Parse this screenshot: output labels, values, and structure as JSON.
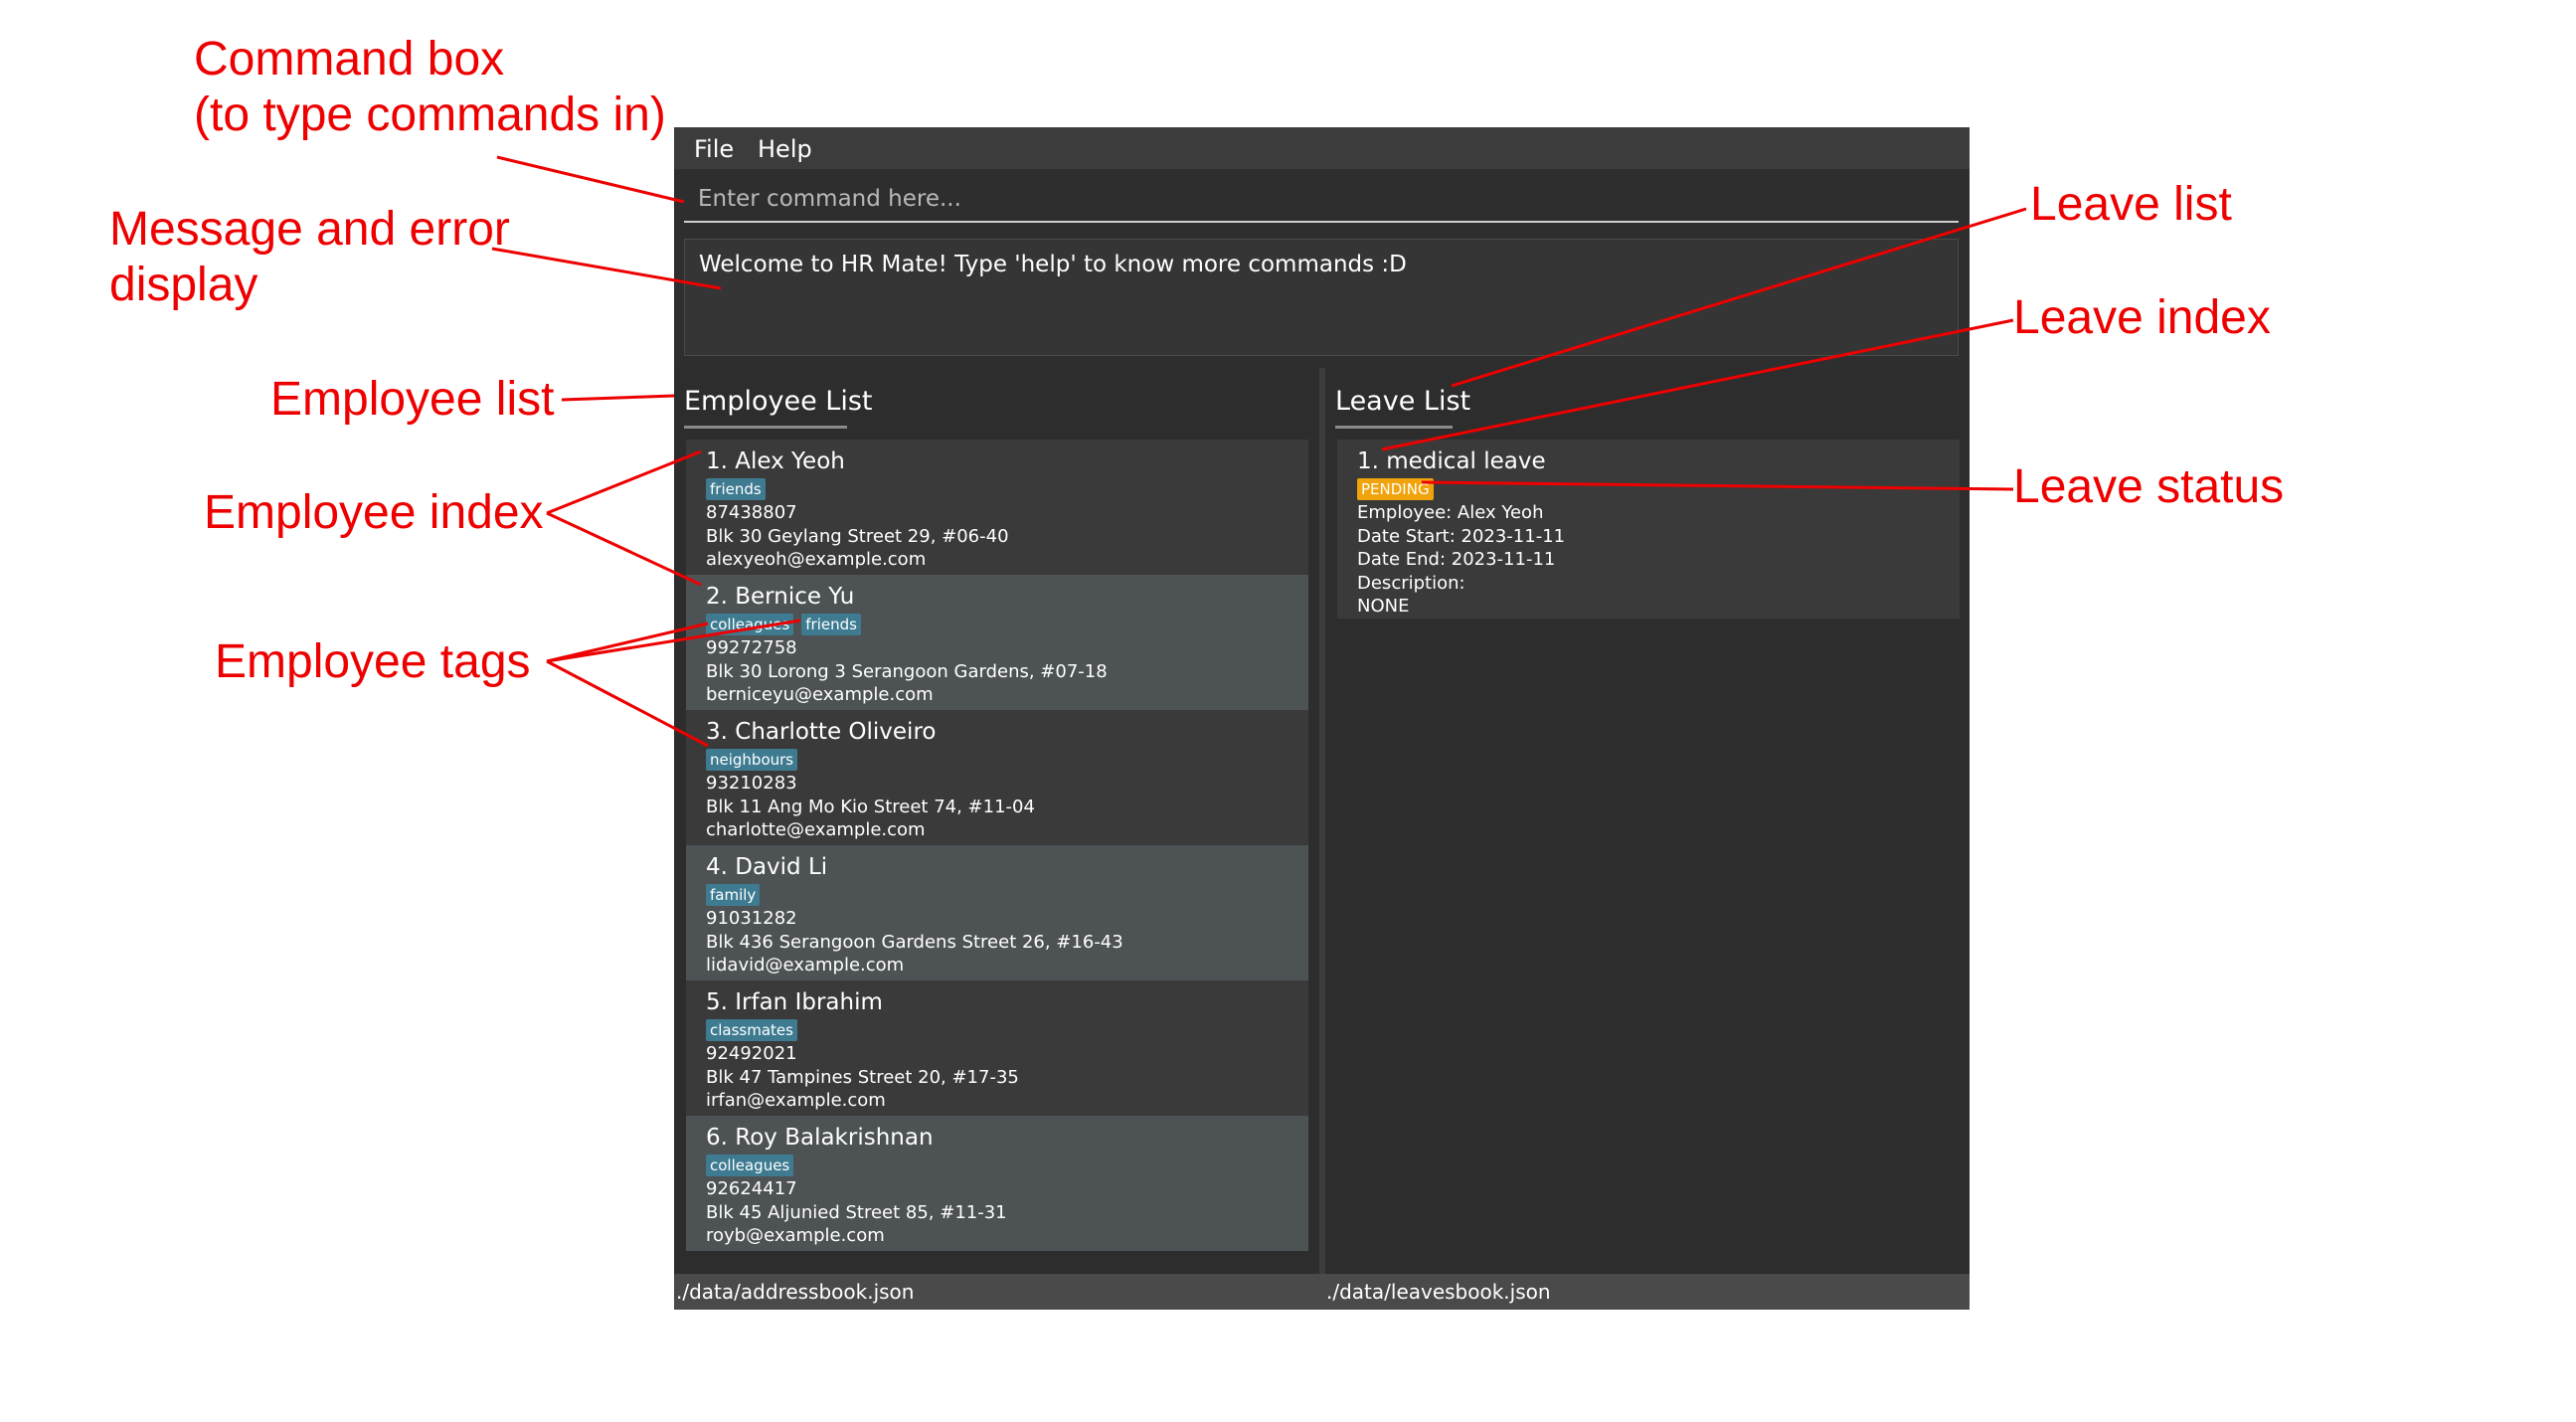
{
  "annotations": {
    "command_box_line1": "Command box",
    "command_box_line2": "(to type commands in)",
    "message_line1": "Message and error",
    "message_line2": "display",
    "employee_list": "Employee list",
    "employee_index": "Employee index",
    "employee_tags": "Employee tags",
    "leave_list": "Leave list",
    "leave_index": "Leave index",
    "leave_status": "Leave status"
  },
  "menu": {
    "file": "File",
    "help": "Help"
  },
  "command": {
    "placeholder": "Enter command here..."
  },
  "result": {
    "text": "Welcome to HR Mate! Type 'help' to know more commands :D"
  },
  "employee_panel": {
    "title": "Employee List",
    "employees": [
      {
        "title": "1.  Alex Yeoh",
        "tags": [
          "friends"
        ],
        "phone": "87438807",
        "address": "Blk 30 Geylang Street 29, #06-40",
        "email": "alexyeoh@example.com"
      },
      {
        "title": "2.  Bernice Yu",
        "tags": [
          "colleagues",
          "friends"
        ],
        "phone": "99272758",
        "address": "Blk 30 Lorong 3 Serangoon Gardens, #07-18",
        "email": "berniceyu@example.com"
      },
      {
        "title": "3.  Charlotte Oliveiro",
        "tags": [
          "neighbours"
        ],
        "phone": "93210283",
        "address": "Blk 11 Ang Mo Kio Street 74, #11-04",
        "email": "charlotte@example.com"
      },
      {
        "title": "4.  David Li",
        "tags": [
          "family"
        ],
        "phone": "91031282",
        "address": "Blk 436 Serangoon Gardens Street 26, #16-43",
        "email": "lidavid@example.com"
      },
      {
        "title": "5.  Irfan Ibrahim",
        "tags": [
          "classmates"
        ],
        "phone": "92492021",
        "address": "Blk 47 Tampines Street 20, #17-35",
        "email": "irfan@example.com"
      },
      {
        "title": "6.  Roy Balakrishnan",
        "tags": [
          "colleagues"
        ],
        "phone": "92624417",
        "address": "Blk 45 Aljunied Street 85, #11-31",
        "email": "royb@example.com"
      }
    ]
  },
  "leave_panel": {
    "title": "Leave List",
    "leaves": [
      {
        "title": "1.  medical leave",
        "status": "PENDING",
        "employee": "Employee: Alex Yeoh",
        "date_start": "Date Start: 2023-11-11",
        "date_end": "Date End: 2023-11-11",
        "description_label": "Description:",
        "description": "NONE"
      }
    ]
  },
  "status_bar": {
    "left": "./data/addressbook.json",
    "right": "./data/leavesbook.json"
  },
  "colors": {
    "annotation": "#ee0000",
    "tag": "#3e7b91",
    "pending": "#f0a30a",
    "window_background": "#3c3c3c",
    "panel_background": "#2d2d2d"
  }
}
